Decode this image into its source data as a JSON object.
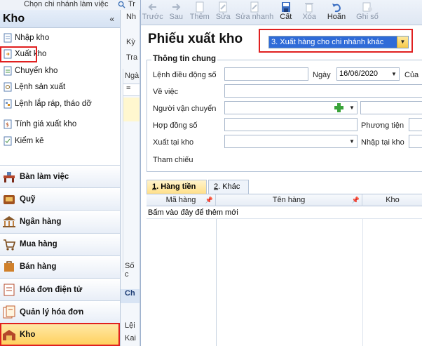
{
  "top_strip": {
    "left_text": "Chọn chi nhánh làm việc",
    "right_text": "Tr"
  },
  "left_panel": {
    "title": "Kho",
    "collapse_glyph": "«",
    "menu_groups": [
      [
        {
          "label": "Nhập kho",
          "icon": "import-doc-icon"
        },
        {
          "label": "Xuất kho",
          "icon": "export-doc-icon",
          "selected": true
        },
        {
          "label": "Chuyển kho",
          "icon": "transfer-doc-icon"
        },
        {
          "label": "Lệnh sản xuất",
          "icon": "production-doc-icon"
        },
        {
          "label": "Lệnh lắp ráp, tháo dỡ",
          "icon": "assembly-doc-icon"
        }
      ],
      [
        {
          "label": "Tính giá xuất kho",
          "icon": "calc-price-icon"
        },
        {
          "label": "Kiểm kê",
          "icon": "inventory-check-icon"
        }
      ]
    ],
    "modules": [
      {
        "label": "Bàn làm việc",
        "icon": "desk-icon"
      },
      {
        "label": "Quỹ",
        "icon": "cash-fund-icon"
      },
      {
        "label": "Ngân hàng",
        "icon": "bank-icon"
      },
      {
        "label": "Mua hàng",
        "icon": "purchase-icon"
      },
      {
        "label": "Bán hàng",
        "icon": "sales-icon"
      },
      {
        "label": "Hóa đơn điện tử",
        "icon": "e-invoice-icon"
      },
      {
        "label": "Quản lý hóa đơn",
        "icon": "invoice-management-icon"
      },
      {
        "label": "Kho",
        "icon": "warehouse-icon",
        "active": true
      }
    ]
  },
  "middle_strip": {
    "labels": [
      "Nh",
      "Kỳ",
      "Tra",
      "Ngà",
      "=",
      "Số c",
      "Ch",
      "Lệi",
      "Kai"
    ]
  },
  "toolbar": {
    "buttons": [
      {
        "label": "Trước",
        "icon": "arrow-left-icon",
        "enabled": false
      },
      {
        "label": "Sau",
        "icon": "arrow-right-icon",
        "enabled": false
      },
      {
        "label": "Thêm",
        "icon": "add-doc-icon",
        "enabled": false
      },
      {
        "label": "Sửa",
        "icon": "edit-icon",
        "enabled": false
      },
      {
        "label": "Sửa nhanh",
        "icon": "quick-edit-icon",
        "enabled": false
      },
      {
        "label": "Cất",
        "icon": "save-icon",
        "enabled": true
      },
      {
        "label": "Xóa",
        "icon": "delete-icon",
        "enabled": false
      },
      {
        "label": "Hoãn",
        "icon": "undo-icon",
        "enabled": true
      },
      {
        "label": "Ghi sổ",
        "icon": "post-ledger-icon",
        "enabled": false
      }
    ]
  },
  "form": {
    "title": "Phiếu xuất kho",
    "type_select": {
      "value": "3. Xuất hàng cho chi nhánh khác",
      "arrow": "▼"
    },
    "section_label": "Thông tin chung",
    "fields": {
      "transfer_order_label": "Lệnh điều động số",
      "transfer_order_value": "",
      "date_label": "Ngày",
      "date_value": "16/06/2020",
      "of_label": "Của",
      "about_label": "Về việc",
      "about_value": "",
      "carrier_label": "Người vận chuyển",
      "carrier_value": "",
      "contract_label": "Hợp đồng số",
      "contract_value": "",
      "vehicle_label": "Phương tiện",
      "vehicle_value": "",
      "export_wh_label": "Xuất tại kho",
      "export_wh_value": "",
      "import_wh_label": "Nhập tại kho",
      "import_wh_value": "",
      "reference_label": "Tham chiếu"
    },
    "tabs": [
      {
        "key": "1",
        "label": "Hàng tiền",
        "active": true
      },
      {
        "key": "2",
        "label": "Khác",
        "active": false
      }
    ],
    "grid": {
      "columns": [
        "Mã hàng",
        "Tên hàng",
        "Kho"
      ],
      "add_row_text": "Bấm vào đây để thêm mới"
    }
  },
  "colors": {
    "highlight_red": "#e02020",
    "accent_blue": "#2f6bd8",
    "module_active": "#ffcf5a"
  }
}
